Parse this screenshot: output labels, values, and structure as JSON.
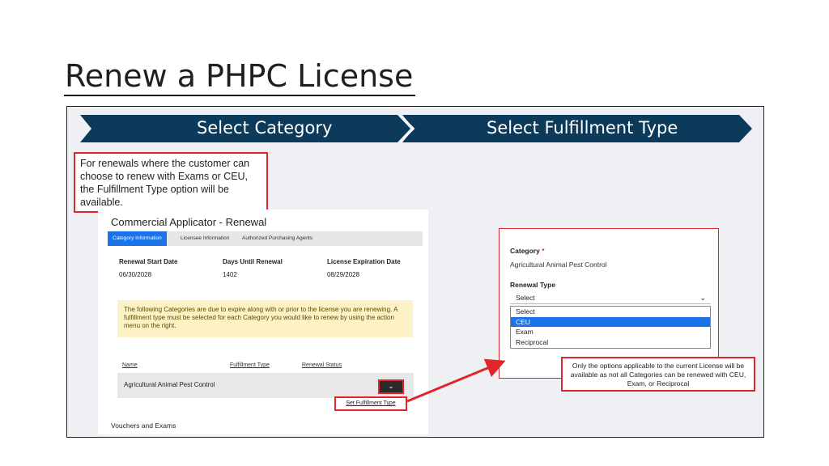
{
  "slide": {
    "title": "Renew a PHPC License"
  },
  "banner": {
    "step1": "Select Category",
    "step2": "Select Fulfillment Type",
    "color": "#0b3a5b"
  },
  "callout_left": {
    "text": "For renewals where the customer can choose to renew with Exams or CEU, the Fulfillment Type option will be available."
  },
  "form": {
    "title": "Commercial Applicator - Renewal",
    "tabs": [
      "Category Information",
      "Licensee Information",
      "Authorized Purchasing Agents"
    ],
    "active_tab": "Category Information",
    "fields": [
      {
        "label": "Renewal Start Date",
        "value": "06/30/2028"
      },
      {
        "label": "Days Until Renewal",
        "value": "1402"
      },
      {
        "label": "License Expiration Date",
        "value": "08/29/2028"
      }
    ],
    "notice": "The following Categories are due to expire along with or prior to the license you are renewing. A fulfillment type must be selected for each Category you would like to renew by using the action menu on the right.",
    "columns": [
      "Name",
      "Fulfillment Type",
      "Renewal Status"
    ],
    "row": {
      "name": "Agricultural Animal Pest Control"
    },
    "action_icon": "chevron-down-icon",
    "set_fulfillment_label": "Set Fulfillment Type",
    "vouchers_label": "Vouchers and Exams"
  },
  "right_panel": {
    "category_label": "Category",
    "required_mark": "*",
    "category_value": "Agricultural Animal Pest Control",
    "renewal_type_label": "Renewal Type",
    "select_value": "Select",
    "options": [
      "Select",
      "CEU",
      "Exam",
      "Reciprocal"
    ],
    "highlighted_option": "CEU"
  },
  "callout_right": {
    "text": "Only the options applicable to the current License will be available as not all Categories can be renewed with CEU, Exam, or Reciprocal"
  },
  "colors": {
    "accent_red": "#e0262b",
    "tab_blue": "#1a73e8",
    "notice_yellow": "#fdf2c6"
  }
}
